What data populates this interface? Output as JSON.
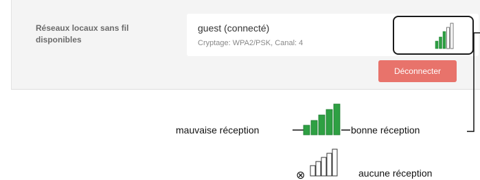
{
  "wifi": {
    "section_label": "Réseaux locaux sans fil disponibles",
    "network_name": "guest (connecté)",
    "network_details": "Cryptage: WPA2/PSK, Canal: 4",
    "disconnect_label": "Déconnecter",
    "signal_bars_filled": 3,
    "signal_bars_total": 5
  },
  "legend": {
    "poor_label": "mauvaise réception",
    "good_label": "bonne réception",
    "none_label": "aucune réception",
    "no_signal_symbol": "⊗"
  },
  "colors": {
    "signal_green": "#2ea043",
    "disconnect_button": "#e8736b",
    "panel_background": "#f4f4f4"
  }
}
